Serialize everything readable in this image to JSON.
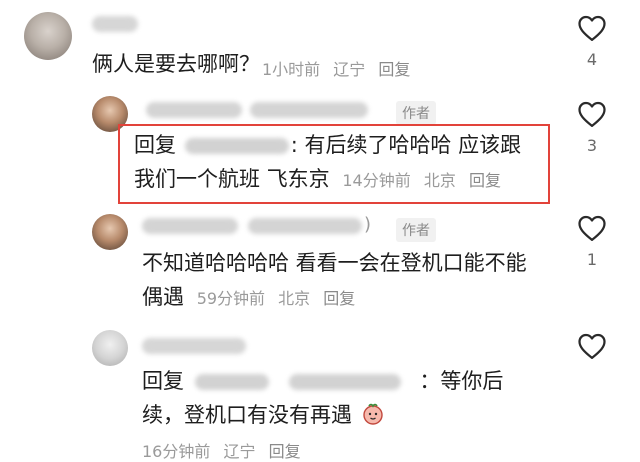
{
  "comments": [
    {
      "text": "俩人是要去哪啊？",
      "time": "1小时前",
      "location": "辽宁",
      "reply_label": "回复",
      "likes": "4"
    },
    {
      "badge": "作者",
      "reply_prefix": "回复",
      "text_line1": ": 有后续了哈哈哈 应该跟",
      "text_line2": "我们一个航班 飞东京",
      "time": "14分钟前",
      "location": "北京",
      "reply_label": "回复",
      "likes": "3"
    },
    {
      "paren": ")",
      "badge": "作者",
      "text_line1": "不知道哈哈哈哈 看看一会在登机口能不能",
      "text_line2": "偶遇",
      "time": "59分钟前",
      "location": "北京",
      "reply_label": "回复",
      "likes": "1"
    },
    {
      "reply_prefix": "回复",
      "text_line1": "：等你后",
      "text_line2": "续，登机口有没有再遇",
      "time": "16分钟前",
      "location": "辽宁",
      "reply_label": "回复",
      "emoji": "sticker-emoji"
    }
  ],
  "colors": {
    "highlight": "#e2433a",
    "meta": "#9a9a9a"
  }
}
